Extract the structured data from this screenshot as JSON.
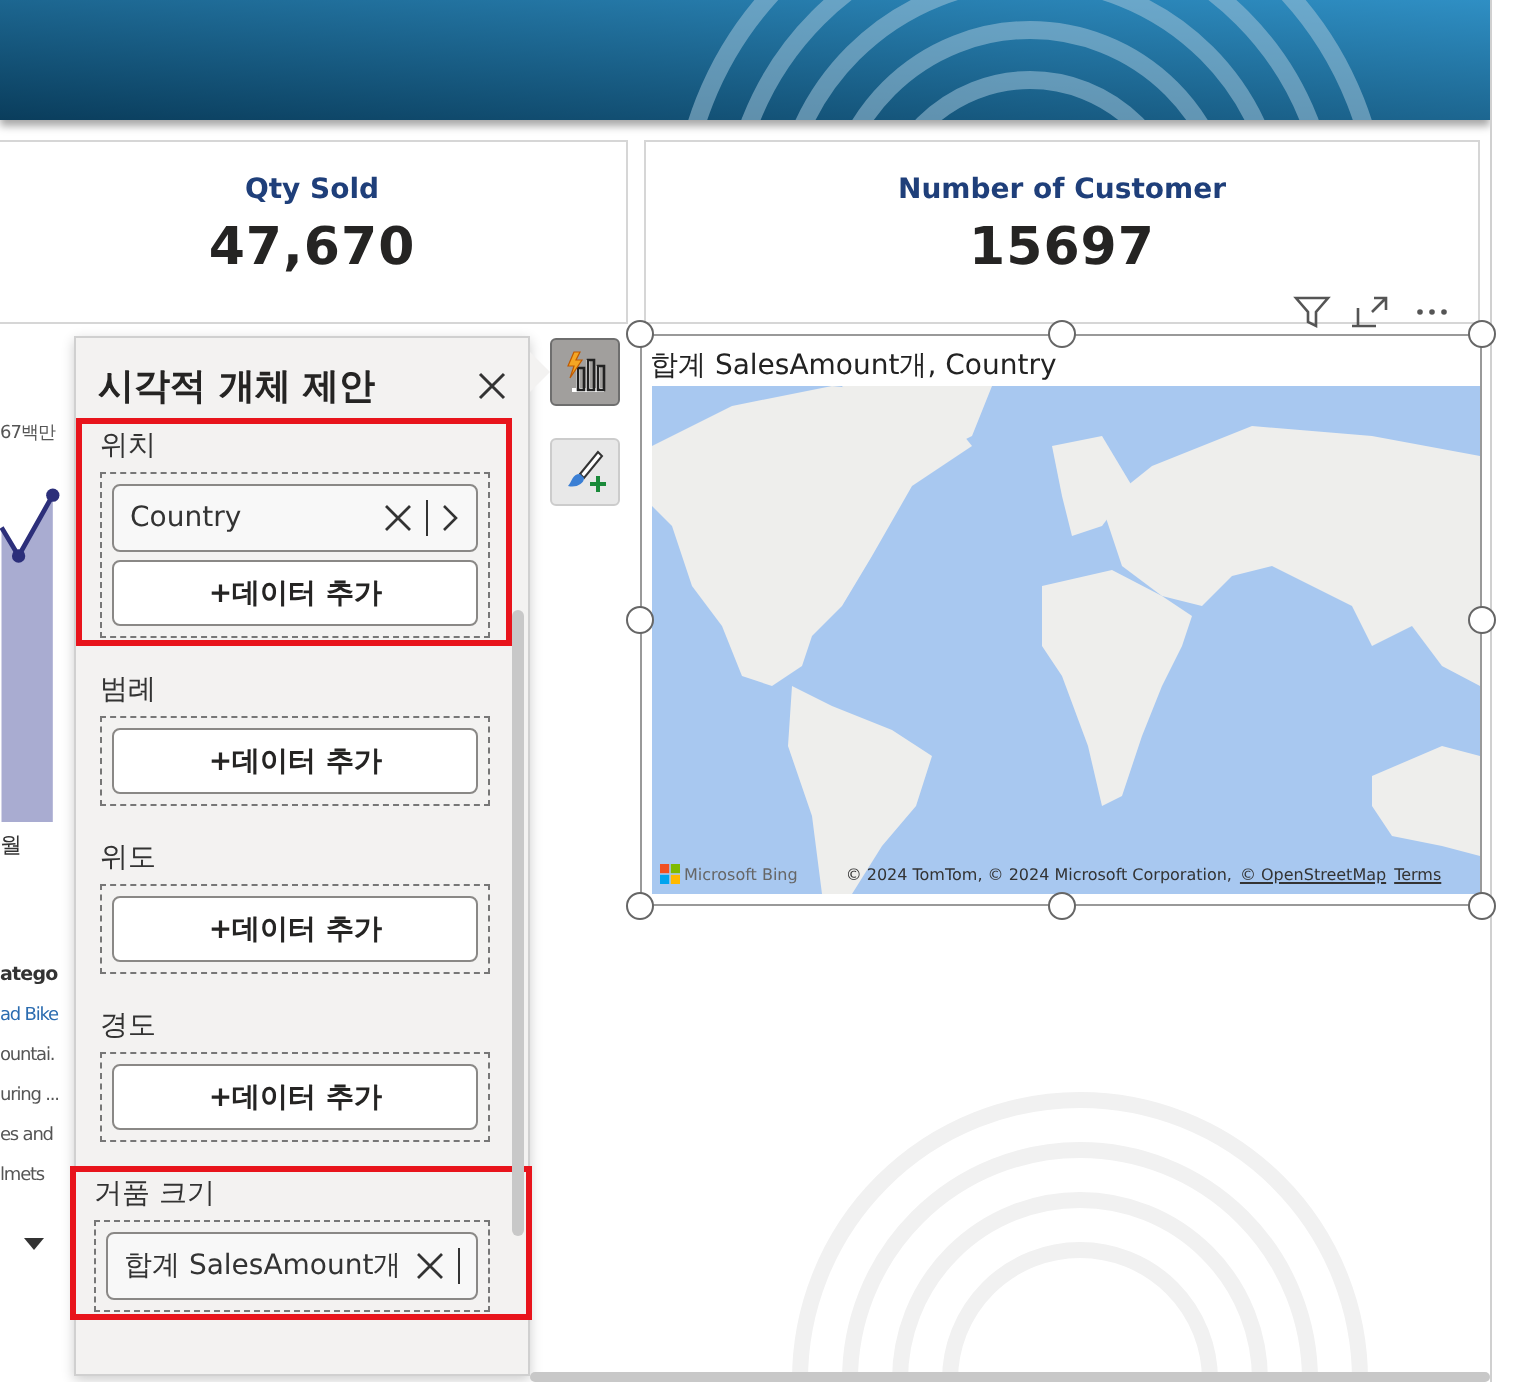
{
  "cards": [
    {
      "title": "Qty Sold",
      "value": "47,670"
    },
    {
      "title": "Number of Customer",
      "value": "15697"
    }
  ],
  "left_chart": {
    "data_label": "67백만",
    "axis_label": "월",
    "list_header": "atego",
    "list_items": [
      "ad Bike",
      "ountai.",
      "uring ...",
      "es and",
      "lmets"
    ]
  },
  "map_visual": {
    "selected": true,
    "title": "합계 SalesAmount개, Country",
    "logo_text": "Microsoft Bing",
    "attribution": "© 2024 TomTom, © 2024 Microsoft Corporation,",
    "links": [
      "© OpenStreetMap",
      "Terms"
    ]
  },
  "suggest_panel": {
    "title": "시각적 개체 제안",
    "wells": [
      {
        "label": "위치",
        "highlighted": true,
        "fields": [
          {
            "name": "Country",
            "expandable": true
          }
        ],
        "add_button": "+데이터 추가"
      },
      {
        "label": "범례",
        "highlighted": false,
        "add_button": "+데이터 추가"
      },
      {
        "label": "위도",
        "highlighted": false,
        "add_button": "+데이터 추가"
      },
      {
        "label": "경도",
        "highlighted": false,
        "add_button": "+데이터 추가"
      },
      {
        "label": "거품 크기",
        "highlighted": true,
        "fields": [
          {
            "name": "합계 SalesAmount개",
            "expandable": false
          }
        ]
      }
    ]
  },
  "side_buttons": [
    {
      "kind": "suggest",
      "selected": true
    },
    {
      "kind": "format",
      "selected": false
    }
  ]
}
